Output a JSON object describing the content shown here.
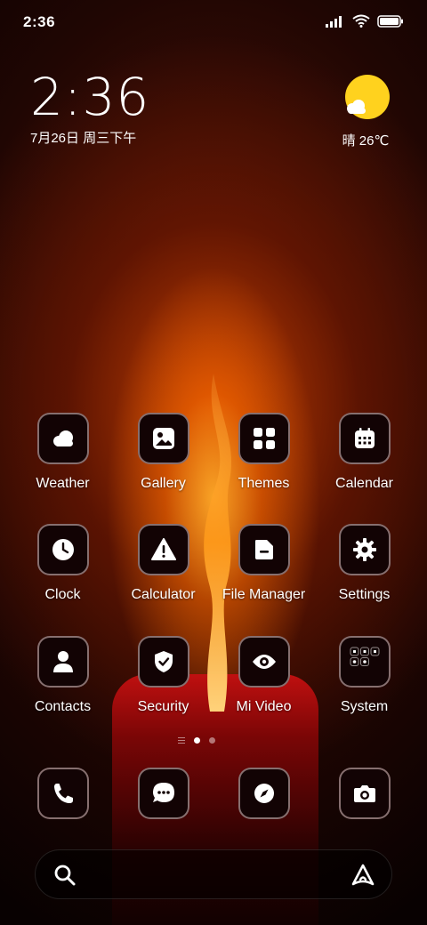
{
  "status_bar": {
    "time": "2:36",
    "icons": [
      "signal-icon",
      "wifi-icon",
      "battery-icon"
    ]
  },
  "clock_widget": {
    "time": "2:36",
    "date": "7月26日 周三下午"
  },
  "weather_widget": {
    "icon": "sun-cloud-icon",
    "text": "晴 26℃"
  },
  "apps": [
    {
      "label": "Weather",
      "icon": "weather-icon"
    },
    {
      "label": "Gallery",
      "icon": "gallery-icon"
    },
    {
      "label": "Themes",
      "icon": "themes-icon"
    },
    {
      "label": "Calendar",
      "icon": "calendar-icon"
    },
    {
      "label": "Clock",
      "icon": "clock-icon"
    },
    {
      "label": "Calculator",
      "icon": "calculator-icon"
    },
    {
      "label": "File Manager",
      "icon": "file-manager-icon"
    },
    {
      "label": "Settings",
      "icon": "settings-gear-icon"
    },
    {
      "label": "Contacts",
      "icon": "contacts-icon"
    },
    {
      "label": "Security",
      "icon": "security-shield-icon"
    },
    {
      "label": "Mi Video",
      "icon": "video-eye-icon"
    },
    {
      "label": "System",
      "icon": "system-folder-icon"
    }
  ],
  "page_indicator": {
    "pages": 2,
    "current": 1
  },
  "dock": [
    {
      "icon": "phone-icon"
    },
    {
      "icon": "messages-icon"
    },
    {
      "icon": "browser-compass-icon"
    },
    {
      "icon": "camera-icon"
    }
  ],
  "search_bar": {
    "icon": "search-icon",
    "assistant_icon": "assistant-icon"
  },
  "colors": {
    "accent_sun": "#FFD21E",
    "icon_background": "#120304"
  }
}
